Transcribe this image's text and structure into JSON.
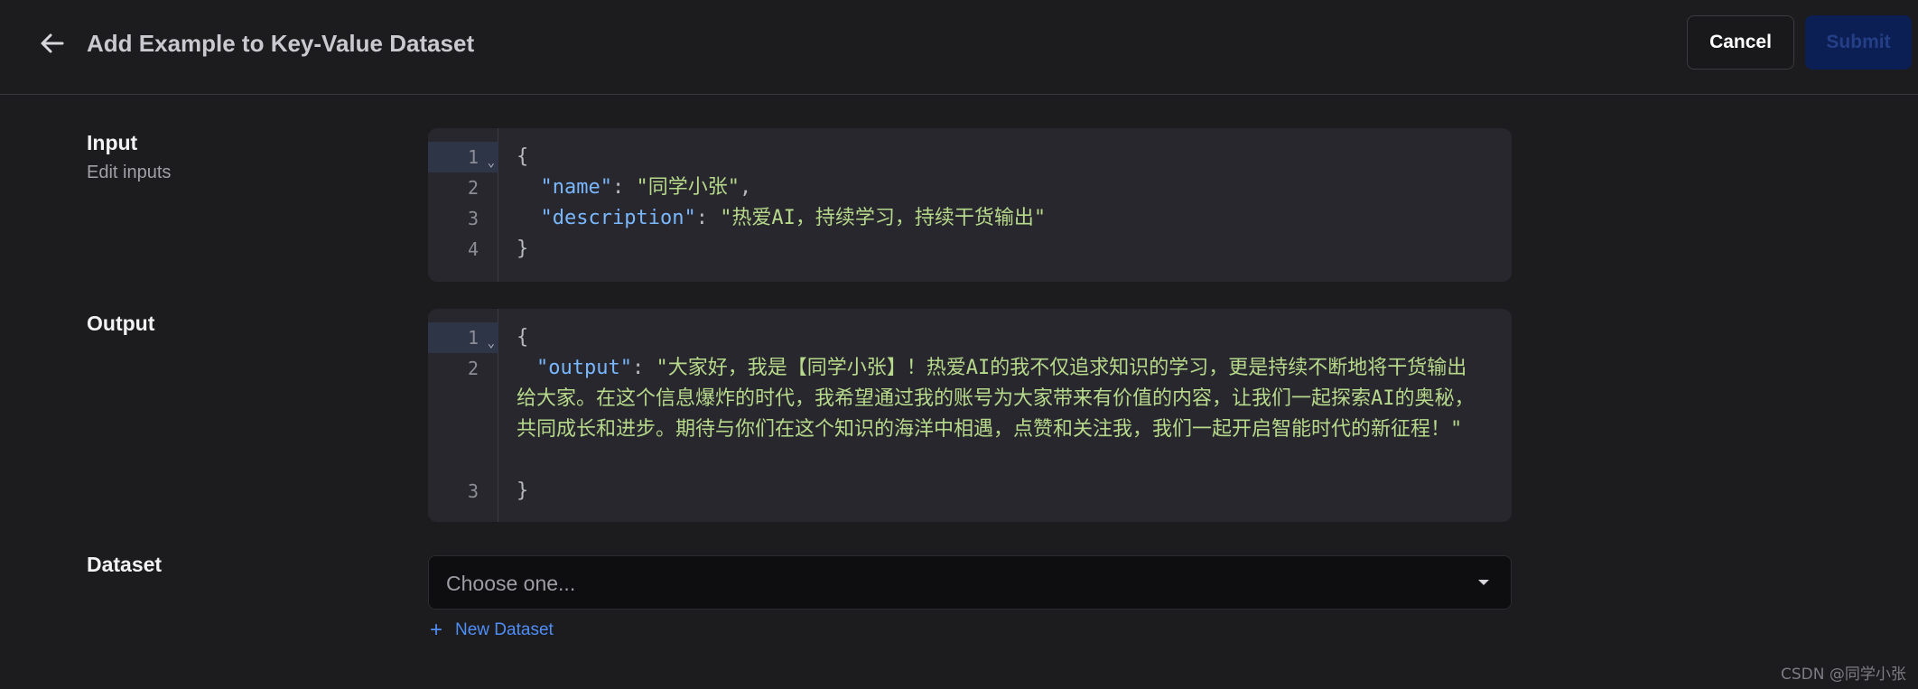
{
  "header": {
    "title": "Add Example to Key-Value Dataset",
    "cancel_label": "Cancel",
    "submit_label": "Submit"
  },
  "input_section": {
    "label": "Input",
    "sublabel": "Edit inputs",
    "line_numbers": [
      "1",
      "2",
      "3",
      "4"
    ],
    "lines": {
      "open": "{",
      "name_key": "\"name\"",
      "name_value": "\"同学小张\"",
      "desc_key": "\"description\"",
      "desc_value": "\"热爱AI，持续学习，持续干货输出\"",
      "close": "}"
    }
  },
  "output_section": {
    "label": "Output",
    "line_numbers": [
      "1",
      "2",
      "3"
    ],
    "lines": {
      "open": "{",
      "output_key": "\"output\"",
      "output_value": "\"大家好，我是【同学小张】！热爱AI的我不仅追求知识的学习，更是持续不断地将干货输出给大家。在这个信息爆炸的时代，我希望通过我的账号为大家带来有价值的内容，让我们一起探索AI的奥秘，共同成长和进步。期待与你们在这个知识的海洋中相遇，点赞和关注我，我们一起开启智能时代的新征程！\"",
      "close": "}"
    }
  },
  "dataset_section": {
    "label": "Dataset",
    "placeholder": "Choose one...",
    "new_dataset_label": "New Dataset"
  },
  "watermark": "CSDN @同学小张",
  "colors": {
    "background": "#1c1c1e",
    "editor_bg": "#27272d",
    "json_key": "#79b8ff",
    "json_string": "#b7d98b",
    "link": "#4f8ef7",
    "submit_bg": "#0c1f55"
  },
  "icons": {
    "back": "arrow-left-icon",
    "fold": "chevron-down-icon",
    "select_caret": "caret-down-icon",
    "add": "plus-icon"
  }
}
